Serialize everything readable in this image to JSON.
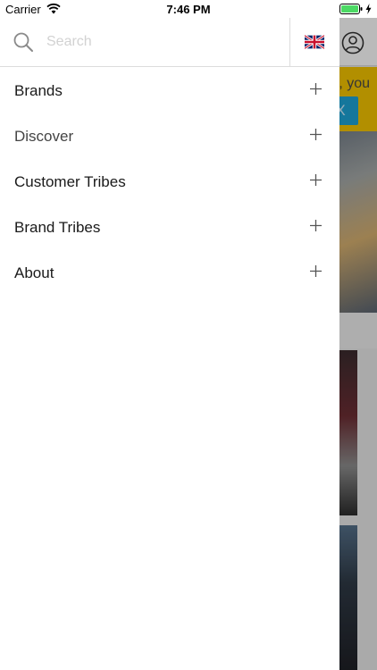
{
  "status_bar": {
    "carrier": "Carrier",
    "time": "7:46 PM",
    "icons": [
      "wifi-icon",
      "battery-icon",
      "charging-icon"
    ]
  },
  "drawer": {
    "search": {
      "placeholder": "Search",
      "value": "",
      "icon": "search-icon"
    },
    "language_flag": "uk-flag-icon",
    "menu_items": [
      {
        "label": "Brands",
        "icon": "plus-icon"
      },
      {
        "label": "Discover",
        "icon": "plus-icon"
      },
      {
        "label": "Customer Tribes",
        "icon": "plus-icon"
      },
      {
        "label": "Brand Tribes",
        "icon": "plus-icon"
      },
      {
        "label": "About",
        "icon": "plus-icon"
      }
    ]
  },
  "background_app": {
    "promo_text": ", you",
    "promo_button_label": "X",
    "profile_icon": "profile-icon"
  },
  "colors": {
    "promo_yellow": "#f4c400",
    "promo_button_blue": "#1ea3d6",
    "battery_green": "#4cd964"
  }
}
